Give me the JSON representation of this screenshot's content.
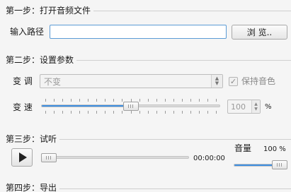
{
  "step1": {
    "title": "第一步：打开音频文件",
    "input_label": "输入路径",
    "path_value": "",
    "browse_label": "浏 览.."
  },
  "step2": {
    "title": "第二步：设置参数",
    "pitch_label": "变 调",
    "pitch_selected": "不变",
    "keep_tone_label": "保持音色",
    "keep_tone_checked": true,
    "speed_label": "变 速",
    "speed_value": "100",
    "speed_unit": "%",
    "speed_slider_fraction": 0.5
  },
  "step3": {
    "title": "第三步：试听",
    "time": "00:00:00",
    "volume_label": "音量",
    "volume_value": "100 %",
    "progress_fraction": 0.0,
    "volume_fraction": 1.0
  },
  "step4": {
    "title": "第四步：导出"
  },
  "icons": {
    "play": "play-icon",
    "check": "checkmark-icon",
    "spin_arrows": "up-down-arrows-icon"
  },
  "colors": {
    "accent": "#3d8ee0",
    "focus_border": "#5b9bd5"
  }
}
